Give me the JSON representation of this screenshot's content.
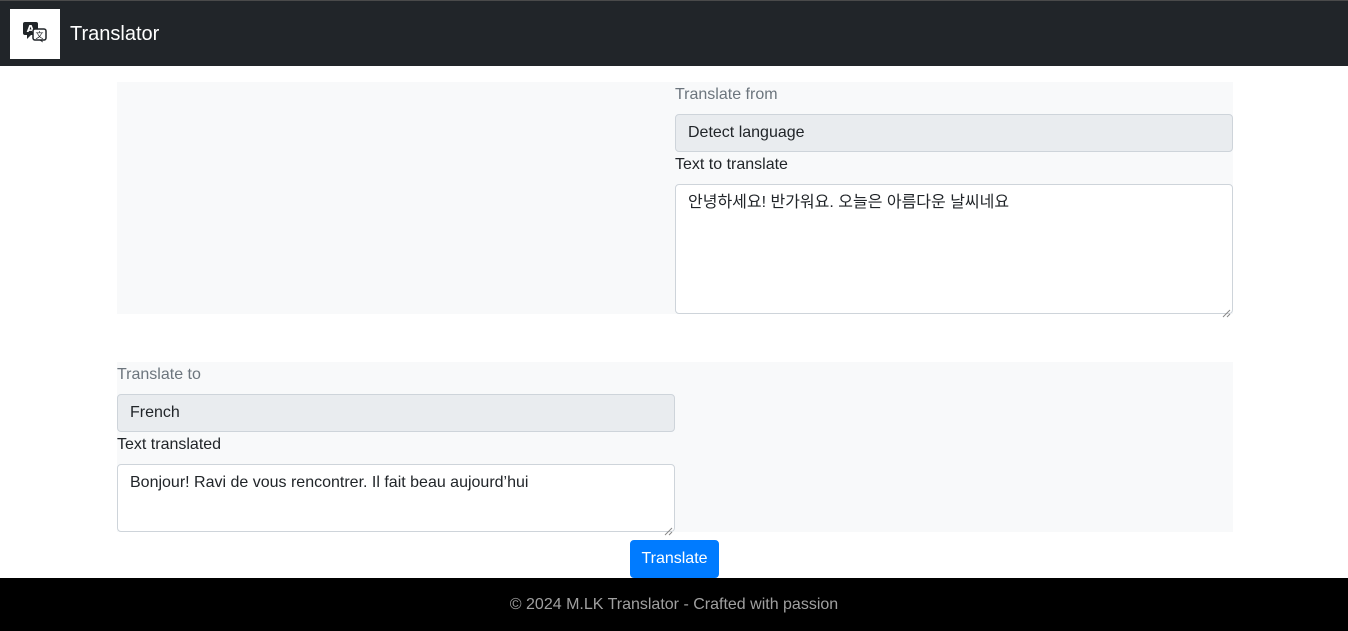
{
  "app": {
    "brand": "Translator",
    "logo_icon": "translate-icon"
  },
  "source": {
    "lang_label": "Translate from",
    "lang_value": "Detect language",
    "text_label": "Text to translate",
    "text_value": "안녕하세요! 반가워요. 오늘은 아름다운 날씨네요"
  },
  "target": {
    "lang_label": "Translate to",
    "lang_value": "French",
    "text_label": "Text translated",
    "text_value": "Bonjour! Ravi de vous rencontrer. Il fait beau aujourd’hui"
  },
  "actions": {
    "translate_label": "Translate"
  },
  "footer": {
    "text": "© 2024 M.LK Translator - Crafted with passion"
  },
  "colors": {
    "navbar_bg": "#212529",
    "primary": "#007bff",
    "panel_bg": "#f8f9fa",
    "footer_bg": "#000000"
  }
}
